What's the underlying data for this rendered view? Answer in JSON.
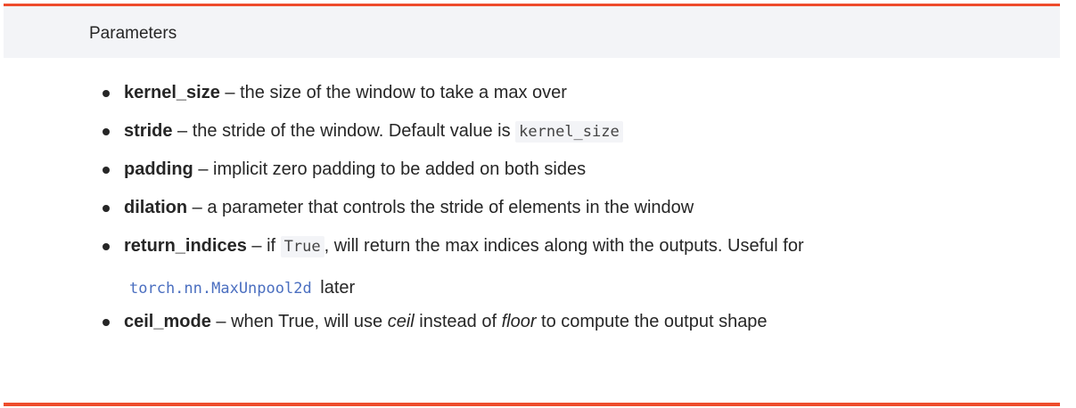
{
  "header": {
    "title": "Parameters"
  },
  "params": [
    {
      "name": "kernel_size",
      "sep": " – ",
      "desc": "the size of the window to take a max over"
    },
    {
      "name": "stride",
      "sep": " – ",
      "desc": "the stride of the window. Default value is ",
      "code": "kernel_size"
    },
    {
      "name": "padding",
      "sep": " – ",
      "desc": "implicit zero padding to be added on both sides"
    },
    {
      "name": "dilation",
      "sep": " – ",
      "desc": "a parameter that controls the stride of elements in the window"
    },
    {
      "name": "return_indices",
      "sep": " – ",
      "desc_before": "if ",
      "code": "True",
      "desc_after": ", will return the max indices along with the outputs. Useful for",
      "link_code": "torch.nn.MaxUnpool2d",
      "desc_end": " later"
    },
    {
      "name": "ceil_mode",
      "sep": " – ",
      "desc_before": "when True, will use ",
      "em1": "ceil",
      "desc_mid": " instead of ",
      "em2": "floor",
      "desc_after": " to compute the output shape"
    }
  ],
  "colors": {
    "accent": "#ee4c2c",
    "header_bg": "#f3f4f7",
    "text": "#262626",
    "link": "#4b6fc0"
  }
}
